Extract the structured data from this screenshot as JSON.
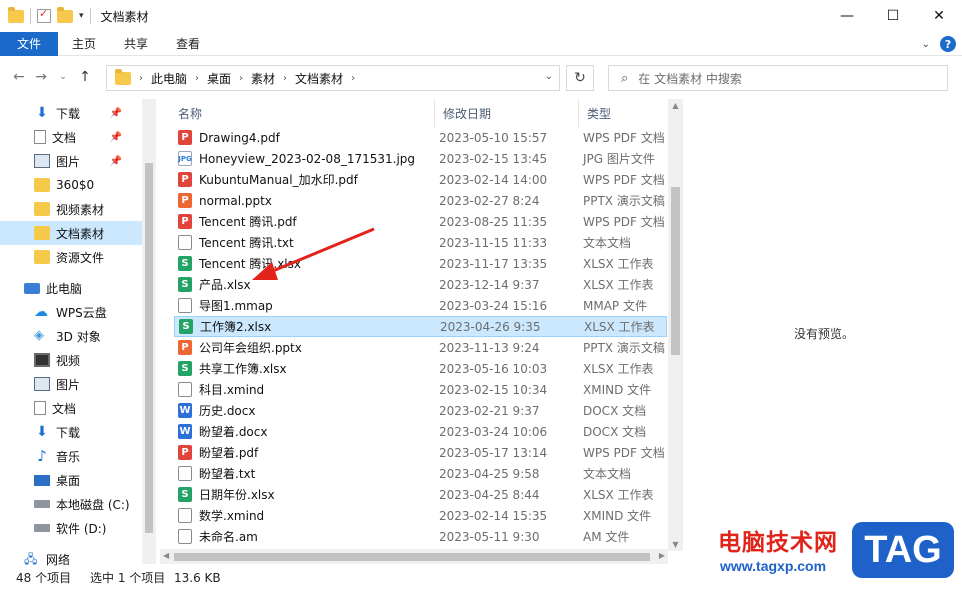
{
  "window": {
    "title": "文档素材"
  },
  "window_controls": [
    "—",
    "☐",
    "✕"
  ],
  "ribbon": {
    "tabs": [
      "文件",
      "主页",
      "共享",
      "查看"
    ],
    "help": "?"
  },
  "nav": {
    "breadcrumb": [
      "此电脑",
      "桌面",
      "素材",
      "文档素材"
    ],
    "search_placeholder": "在 文档素材 中搜索"
  },
  "sidebar": {
    "quick_access": [
      {
        "label": "下载",
        "icon": "download-icon",
        "pinned": true
      },
      {
        "label": "文档",
        "icon": "document-icon",
        "pinned": true
      },
      {
        "label": "图片",
        "icon": "picture-icon",
        "pinned": true
      },
      {
        "label": "360$0",
        "icon": "folder-icon"
      },
      {
        "label": "视频素材",
        "icon": "folder-icon"
      },
      {
        "label": "文档素材",
        "icon": "folder-icon",
        "selected": true
      },
      {
        "label": "资源文件",
        "icon": "folder-icon"
      }
    ],
    "this_pc": "此电脑",
    "pc_items": [
      {
        "label": "WPS云盘",
        "icon": "cloud-icon"
      },
      {
        "label": "3D 对象",
        "icon": "3d-objects-icon"
      },
      {
        "label": "视频",
        "icon": "video-icon"
      },
      {
        "label": "图片",
        "icon": "picture-icon"
      },
      {
        "label": "文档",
        "icon": "document-icon"
      },
      {
        "label": "下载",
        "icon": "download-icon"
      },
      {
        "label": "音乐",
        "icon": "music-icon"
      },
      {
        "label": "桌面",
        "icon": "desktop-icon"
      },
      {
        "label": "本地磁盘 (C:)",
        "icon": "drive-icon"
      },
      {
        "label": "软件 (D:)",
        "icon": "drive-icon"
      }
    ],
    "network": "网络"
  },
  "columns": {
    "name": "名称",
    "date": "修改日期",
    "type": "类型"
  },
  "files": [
    {
      "name": "Drawing4.pdf",
      "date": "2023-05-10 15:57",
      "type": "WPS PDF 文档",
      "kind": "pdf"
    },
    {
      "name": "Honeyview_2023-02-08_171531.jpg",
      "date": "2023-02-15 13:45",
      "type": "JPG 图片文件",
      "kind": "jpg"
    },
    {
      "name": "KubuntuManual_加水印.pdf",
      "date": "2023-02-14 14:00",
      "type": "WPS PDF 文档",
      "kind": "pdf"
    },
    {
      "name": "normal.pptx",
      "date": "2023-02-27 8:24",
      "type": "PPTX 演示文稿",
      "kind": "pptx"
    },
    {
      "name": "Tencent 腾讯.pdf",
      "date": "2023-08-25 11:35",
      "type": "WPS PDF 文档",
      "kind": "pdf"
    },
    {
      "name": "Tencent 腾讯.txt",
      "date": "2023-11-15 11:33",
      "type": "文本文档",
      "kind": "txt"
    },
    {
      "name": "Tencent 腾讯.xlsx",
      "date": "2023-11-17 13:35",
      "type": "XLSX 工作表",
      "kind": "xlsx"
    },
    {
      "name": "产品.xlsx",
      "date": "2023-12-14 9:37",
      "type": "XLSX 工作表",
      "kind": "xlsx"
    },
    {
      "name": "导图1.mmap",
      "date": "2023-03-24 15:16",
      "type": "MMAP 文件",
      "kind": "plain"
    },
    {
      "name": "工作簿2.xlsx",
      "date": "2023-04-26 9:35",
      "type": "XLSX 工作表",
      "kind": "xlsx",
      "selected": true
    },
    {
      "name": "公司年会组织.pptx",
      "date": "2023-11-13 9:24",
      "type": "PPTX 演示文稿",
      "kind": "pptx"
    },
    {
      "name": "共享工作簿.xlsx",
      "date": "2023-05-16 10:03",
      "type": "XLSX 工作表",
      "kind": "xlsx"
    },
    {
      "name": "科目.xmind",
      "date": "2023-02-15 10:34",
      "type": "XMIND 文件",
      "kind": "plain"
    },
    {
      "name": "历史.docx",
      "date": "2023-02-21 9:37",
      "type": "DOCX 文档",
      "kind": "docx"
    },
    {
      "name": "盼望着.docx",
      "date": "2023-03-24 10:06",
      "type": "DOCX 文档",
      "kind": "docx"
    },
    {
      "name": "盼望着.pdf",
      "date": "2023-05-17 13:14",
      "type": "WPS PDF 文档",
      "kind": "pdf"
    },
    {
      "name": "盼望着.txt",
      "date": "2023-04-25 9:58",
      "type": "文本文档",
      "kind": "txt"
    },
    {
      "name": "日期年份.xlsx",
      "date": "2023-04-25 8:44",
      "type": "XLSX 工作表",
      "kind": "xlsx"
    },
    {
      "name": "数学.xmind",
      "date": "2023-02-14 15:35",
      "type": "XMIND 文件",
      "kind": "plain"
    },
    {
      "name": "未命名.am",
      "date": "2023-05-11 9:30",
      "type": "AM 文件",
      "kind": "plain"
    }
  ],
  "preview": {
    "text": "没有预览。"
  },
  "status": {
    "count": "48 个项目",
    "selection": "选中 1 个项目",
    "size": "13.6 KB"
  },
  "watermark": {
    "cn": "电脑技术网",
    "url": "www.tagxp.com",
    "tag": "TAG"
  }
}
